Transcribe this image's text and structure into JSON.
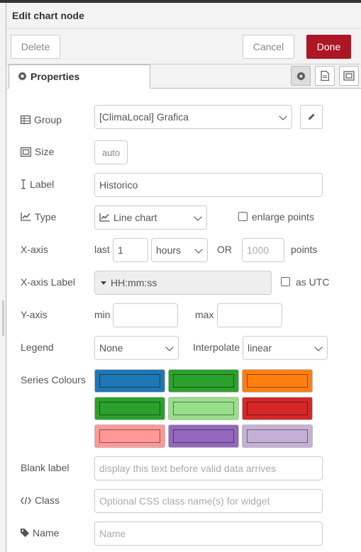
{
  "tray": {
    "title": "Edit chart node",
    "delete_label": "Delete",
    "cancel_label": "Cancel",
    "done_label": "Done"
  },
  "tabs": {
    "properties_label": "Properties"
  },
  "form": {
    "group": {
      "label": "Group",
      "value": "[ClimaLocal] Grafica"
    },
    "size": {
      "label": "Size",
      "value": "auto"
    },
    "label_field": {
      "label": "Label",
      "value": "Historico"
    },
    "type": {
      "label": "Type",
      "value": "Line chart",
      "enlarge_label": "enlarge points"
    },
    "xaxis": {
      "label": "X-axis",
      "last_label": "last",
      "last_value": "1",
      "unit_value": "hours",
      "or_label": "OR",
      "points_placeholder": "1000",
      "points_label": "points"
    },
    "xaxis_label": {
      "label": "X-axis Label",
      "value": "HH:mm:ss",
      "utc_label": "as UTC"
    },
    "yaxis": {
      "label": "Y-axis",
      "min_label": "min",
      "max_label": "max"
    },
    "legend": {
      "label": "Legend",
      "value": "None",
      "interpolate_label": "Interpolate",
      "interpolate_value": "linear"
    },
    "series_colours": {
      "label": "Series Colours",
      "colors": [
        "#1f77b4",
        "#2ca02c",
        "#ff7f0e",
        "#2ca02c",
        "#98df8a",
        "#d62728",
        "#ff9896",
        "#9467bd",
        "#c5b0d5"
      ]
    },
    "blank_label": {
      "label": "Blank label",
      "placeholder": "display this text before valid data arrives"
    },
    "class_field": {
      "label": "Class",
      "placeholder": "Optional CSS class name(s) for widget"
    },
    "name_field": {
      "label": "Name",
      "placeholder": "Name"
    }
  },
  "colors": {
    "primary": "#ad1625"
  }
}
